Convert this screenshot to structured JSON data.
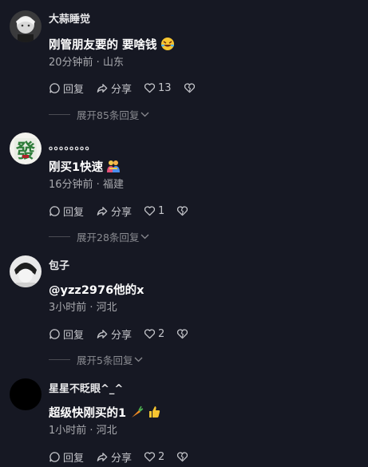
{
  "colors": {
    "background": "#161823",
    "text_primary": "#ffffff",
    "text_secondary": "#a8a9ae",
    "divider": "#4a4b52"
  },
  "actions": {
    "reply_label": "回复",
    "share_label": "分享",
    "like_icon": "heart-icon",
    "dislike_icon": "broken-heart-icon"
  },
  "comments": [
    {
      "username": "大蒜睡觉",
      "content": "刚管朋友要的 要啥钱",
      "emoji": "rofl-emoji",
      "meta": "20分钟前 · 山东",
      "likes": "13",
      "expand": "展开85条回复"
    },
    {
      "username": "。。。。。。。。",
      "content": "刚买1快速",
      "emoji": "hugging-people-emoji",
      "meta": "16分钟前 · 福建",
      "likes": "1",
      "expand": "展开28条回复"
    },
    {
      "username": "包子",
      "content": "@yzz2976他的x",
      "meta": "3小时前 · 河北",
      "likes": "2",
      "expand": "展开5条回复"
    },
    {
      "username": "星星不眨眼^_^",
      "content": "超级快刚买的1",
      "emoji": "carrot-thumbsup-emoji",
      "meta": "1小时前 · 河北",
      "likes": "2"
    }
  ]
}
